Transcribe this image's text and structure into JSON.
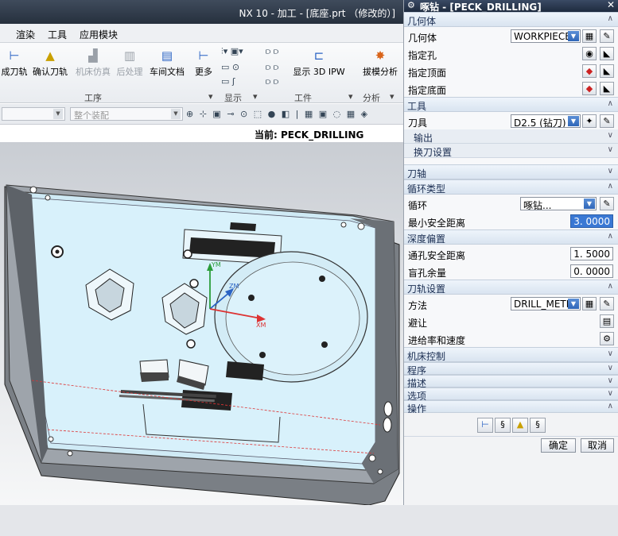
{
  "window": {
    "title": "NX 10 - 加工 - [底座.prt （修改的）]"
  },
  "menubar": [
    "渲染",
    "工具",
    "应用模块"
  ],
  "ribbon": {
    "buttons": [
      {
        "label": "成刀轨",
        "icon": "generate-toolpath-icon",
        "grey": false
      },
      {
        "label": "确认刀轨",
        "icon": "verify-toolpath-icon",
        "grey": false
      },
      {
        "label": "机床仿真",
        "icon": "machine-simulation-icon",
        "grey": true
      },
      {
        "label": "后处理",
        "icon": "postprocess-icon",
        "grey": true
      },
      {
        "label": "车间文档",
        "icon": "shop-documentation-icon",
        "grey": false
      },
      {
        "label": "更多",
        "icon": "more-icon",
        "grey": false
      },
      {
        "label": "显示 3D IPW",
        "icon": "display-3d-ipw-icon",
        "grey": false
      },
      {
        "label": "拔模分析",
        "icon": "draft-analysis-icon",
        "grey": false
      }
    ],
    "groups": [
      "工序",
      "显示",
      "工件",
      "分析"
    ]
  },
  "toolbar2": {
    "assembly_filter": "整个装配"
  },
  "viewport": {
    "current_label": "当前: PECK_DRILLING",
    "axes": {
      "x": "XM",
      "y": "YM",
      "z": "ZM"
    }
  },
  "dialog": {
    "title": "啄钻 - [PECK_DRILLING]",
    "sections": {
      "geometry": "几何体",
      "tool": "工具",
      "tool_axis": "刀轴",
      "cycle_type": "循环类型",
      "depth_offset": "深度偏置",
      "path_settings": "刀轨设置",
      "machine_control": "机床控制",
      "program": "程序",
      "description": "描述",
      "options": "选项",
      "actions": "操作"
    },
    "geometry_label": "几何体",
    "geometry_value": "WORKPIECE",
    "specify_holes": "指定孔",
    "specify_top": "指定顶面",
    "specify_bottom": "指定底面",
    "tool_label": "刀具",
    "tool_value": "D2.5 (钻刀)",
    "output": "输出",
    "tool_change": "换刀设置",
    "cycle_label": "循环",
    "cycle_value": "啄钻...",
    "min_clearance_label": "最小安全距离",
    "min_clearance_value": "3. 0000",
    "through_hole_label": "通孔安全距离",
    "through_hole_value": "1. 5000",
    "blind_hole_label": "盲孔余量",
    "blind_hole_value": "0. 0000",
    "method_label": "方法",
    "method_value": "DRILL_METH",
    "avoid_label": "避让",
    "feeds_label": "进给率和速度",
    "ok": "确定",
    "cancel": "取消"
  }
}
